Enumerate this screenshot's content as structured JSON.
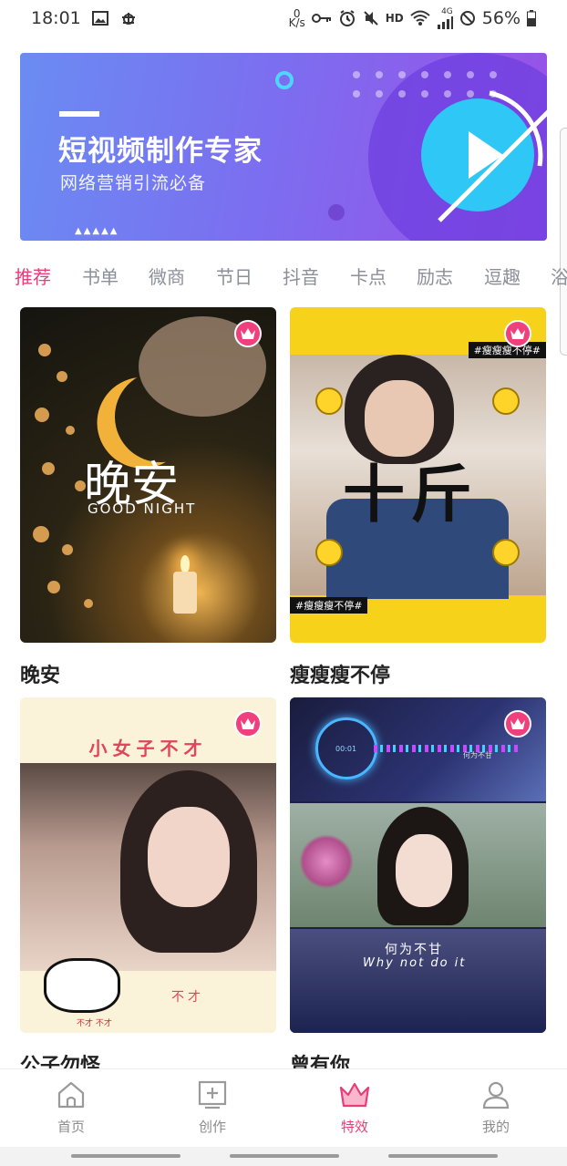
{
  "status_bar": {
    "time": "18:01",
    "net_speed_top": "0",
    "net_speed_unit": "K/s",
    "hd": "HD",
    "signal": "4G",
    "battery": "56%"
  },
  "banner": {
    "title": "短视频制作专家",
    "subtitle": "网络营销引流必备"
  },
  "tabs": [
    {
      "label": "推荐"
    },
    {
      "label": "书单"
    },
    {
      "label": "微商"
    },
    {
      "label": "节日"
    },
    {
      "label": "抖音"
    },
    {
      "label": "卡点"
    },
    {
      "label": "励志"
    },
    {
      "label": "逗趣"
    },
    {
      "label": "浴"
    }
  ],
  "active_tab": "推荐",
  "cards": [
    {
      "name": "晚安",
      "overlay_main": "晚安",
      "overlay_sub": "GOOD NIGHT"
    },
    {
      "name": "瘦瘦瘦不停",
      "overlay_main": "十斤",
      "tag": "#瘦瘦瘦不停#"
    },
    {
      "name": "公子勿怪",
      "overlay_main": "小女子不才",
      "overlay_sub": "不才",
      "overlay_small": "不才 不才"
    },
    {
      "name": "曾有你",
      "overlay_main": "何为不甘",
      "overlay_sub": "Why not do it",
      "overlay_caption": "何为不甘",
      "overlay_time": "00:01"
    }
  ],
  "bottom_nav": [
    {
      "label": "首页",
      "icon": "home-icon"
    },
    {
      "label": "创作",
      "icon": "create-icon"
    },
    {
      "label": "特效",
      "icon": "crown-icon"
    },
    {
      "label": "我的",
      "icon": "user-icon"
    }
  ],
  "active_nav": "特效",
  "colors": {
    "accent": "#e93d78",
    "tab_inactive": "#8a9099",
    "nav_inactive": "#8c8c8c",
    "banner_start": "#6a8cf2",
    "banner_end": "#9a4fe6"
  }
}
